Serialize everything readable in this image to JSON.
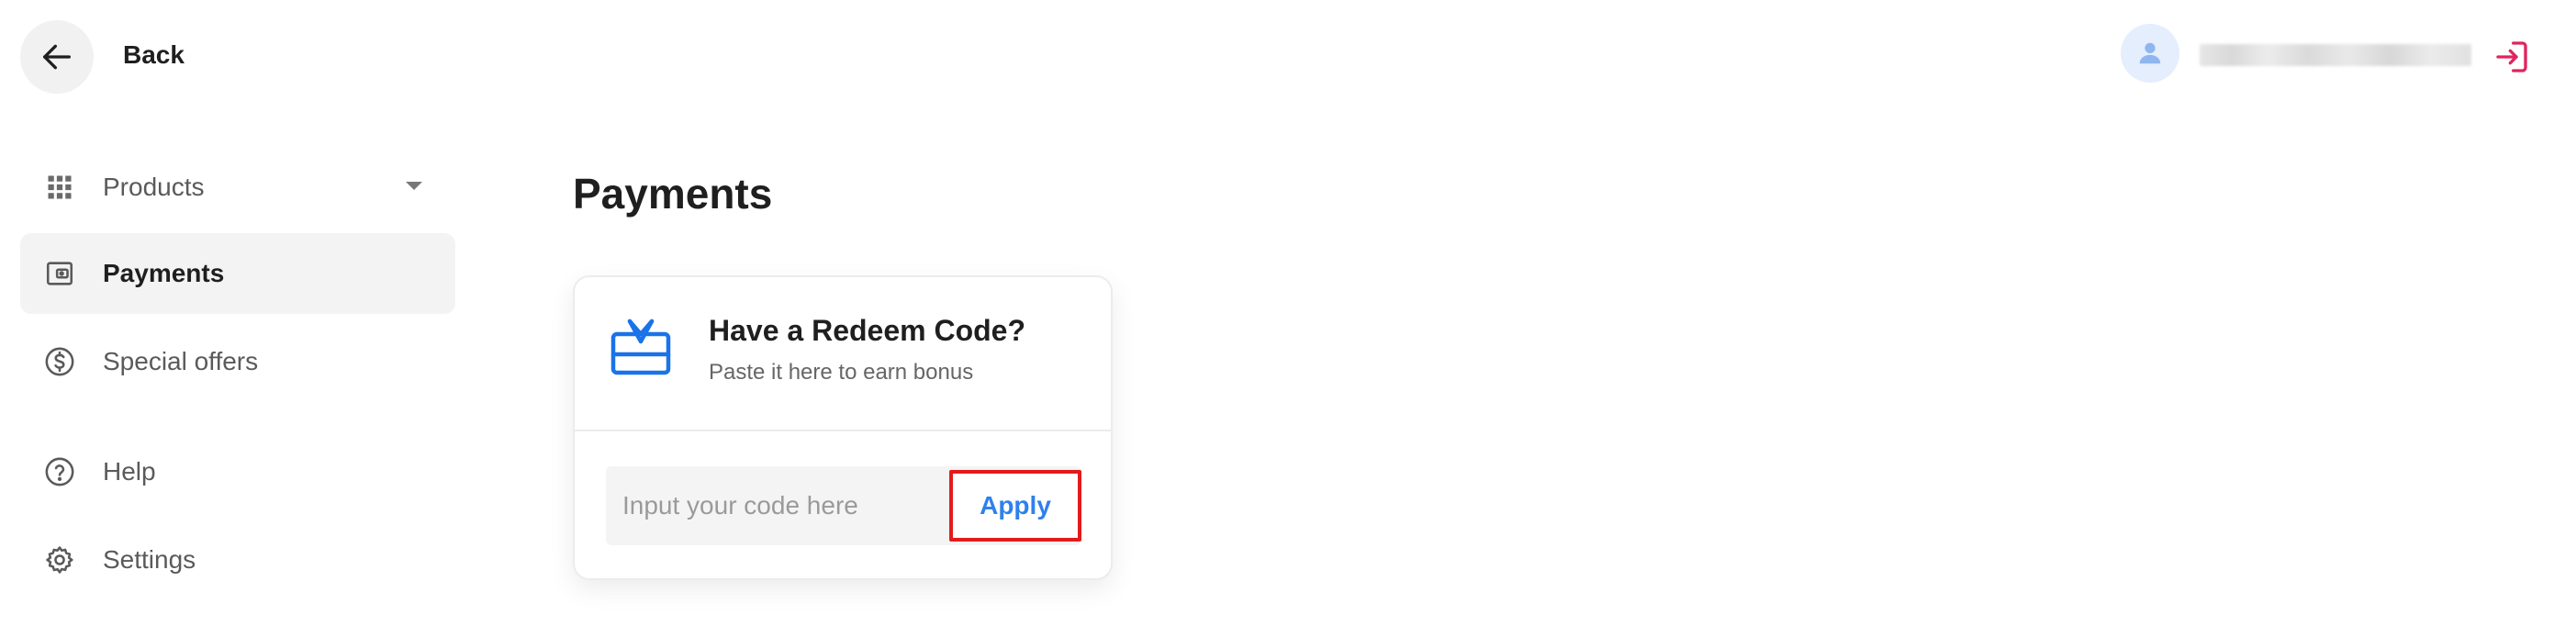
{
  "header": {
    "back_label": "Back",
    "user": {
      "avatar_icon": "user-icon",
      "name": ""
    },
    "logout_icon": "logout-icon"
  },
  "sidebar": {
    "items": [
      {
        "label": "Products",
        "icon": "grid-icon",
        "has_dropdown": true,
        "active": false
      },
      {
        "label": "Payments",
        "icon": "wallet-icon",
        "active": true
      },
      {
        "label": "Special offers",
        "icon": "dollar-circle-icon",
        "active": false
      },
      {
        "label": "Help",
        "icon": "help-circle-icon",
        "active": false
      },
      {
        "label": "Settings",
        "icon": "gear-icon",
        "active": false
      }
    ]
  },
  "main": {
    "title": "Payments",
    "redeem": {
      "icon": "gift-card-icon",
      "heading": "Have a Redeem Code?",
      "subheading": "Paste it here to earn bonus",
      "input_placeholder": "Input your code here",
      "input_value": "",
      "apply_label": "Apply"
    }
  },
  "colors": {
    "accent_blue": "#2f80ed",
    "highlight_red": "#e21b1b",
    "logout_red": "#e0245e",
    "active_bg": "#f3f3f3"
  }
}
